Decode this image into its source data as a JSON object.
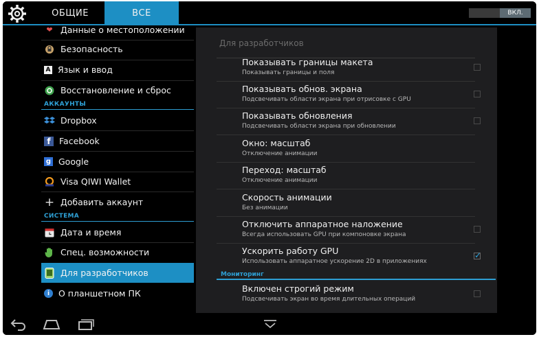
{
  "topbar": {
    "tab_general": "ОБЩИЕ",
    "tab_all": "ВСЕ",
    "toggle_label": "ВКЛ."
  },
  "sidebar": {
    "items": [
      {
        "label": "Данные о местоположении",
        "icon": "location-icon"
      },
      {
        "label": "Безопасность",
        "icon": "lock-icon"
      },
      {
        "label": "Язык и ввод",
        "icon": "language-icon"
      },
      {
        "label": "Восстановление и сброс",
        "icon": "restore-icon"
      }
    ],
    "accounts_header": "АККАУНТЫ",
    "accounts": [
      {
        "label": "Dropbox",
        "icon": "dropbox-icon"
      },
      {
        "label": "Facebook",
        "icon": "facebook-icon"
      },
      {
        "label": "Google",
        "icon": "google-icon"
      },
      {
        "label": "Visa QIWI Wallet",
        "icon": "qiwi-icon"
      },
      {
        "label": "Добавить аккаунт",
        "icon": "plus-icon"
      }
    ],
    "system_header": "СИСТЕМА",
    "system": [
      {
        "label": "Дата и время",
        "icon": "clock-icon"
      },
      {
        "label": "Спец. возможности",
        "icon": "hand-icon"
      },
      {
        "label": "Для разработчиков",
        "icon": "developer-icon",
        "selected": true
      },
      {
        "label": "О планшетном ПК",
        "icon": "info-icon"
      }
    ]
  },
  "panel": {
    "title": "Для разработчиков",
    "items": [
      {
        "title": "Показывать границы макета",
        "subtitle": "Показывать границы и поля",
        "checkbox": true,
        "checked": false
      },
      {
        "title": "Показывать обнов. экрана",
        "subtitle": "Подсвечивать области экрана при отрисовке с GPU",
        "checkbox": true,
        "checked": false
      },
      {
        "title": "Показывать обновления",
        "subtitle": "Подсвечивать области экрана при обновлении",
        "checkbox": true,
        "checked": false
      },
      {
        "title": "Окно: масштаб",
        "subtitle": "Отключение анимации",
        "checkbox": false,
        "checked": false
      },
      {
        "title": "Переход: масштаб",
        "subtitle": "Отключение анимации",
        "checkbox": false,
        "checked": false
      },
      {
        "title": "Скорость анимации",
        "subtitle": "Без анимации",
        "checkbox": false,
        "checked": false
      },
      {
        "title": "Отключить аппаратное наложение",
        "subtitle": "Всегда использовать GPU при компоновке экрана",
        "checkbox": true,
        "checked": false
      },
      {
        "title": "Ускорить работу GPU",
        "subtitle": "Использовать аппаратное ускорение 2D в приложениях",
        "checkbox": true,
        "checked": true
      }
    ],
    "monitoring_header": "Мониторинг",
    "monitoring": [
      {
        "title": "Включен строгий режим",
        "subtitle": "Подсвечивать экран во время длительных операций",
        "checkbox": true,
        "checked": false
      }
    ]
  },
  "navbar": {
    "back": "back-icon",
    "home": "home-icon",
    "recents": "recents-icon",
    "menu": "chevron-down-icon"
  },
  "colors": {
    "accent": "#1d8fc4",
    "background": "#000000",
    "panel": "#1e1e20"
  }
}
